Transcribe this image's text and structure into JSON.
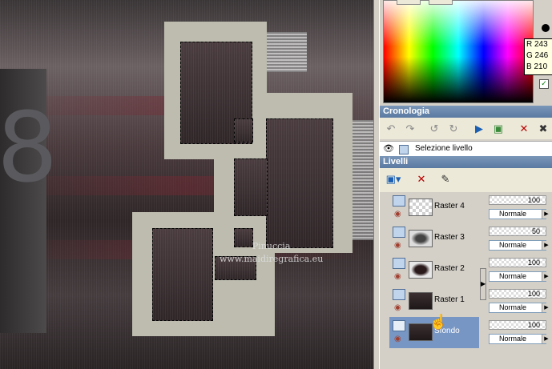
{
  "canvas": {
    "watermark_line1": "Pinuccia",
    "watermark_line2": "www.maidiregrafica.eu",
    "left_glyph": "8"
  },
  "color_picker": {
    "r": "R 243",
    "g": "G 246",
    "b": "B 210",
    "check": "✓"
  },
  "history": {
    "title": "Cronologia",
    "row_label": "Selezione livello",
    "tools": [
      "undo-icon",
      "redo-icon",
      "undo-alt-icon",
      "redo-alt-icon",
      "history-apply-icon",
      "history-copy-icon",
      "delete-history-icon",
      "clear-history-icon"
    ]
  },
  "layers": {
    "title": "Livelli",
    "items": [
      {
        "name": "Raster 4",
        "opacity": "100",
        "blend": "Normale"
      },
      {
        "name": "Raster 3",
        "opacity": "50",
        "blend": "Normale"
      },
      {
        "name": "Raster 2",
        "opacity": "100",
        "blend": "Normale"
      },
      {
        "name": "Raster 1",
        "opacity": "100",
        "blend": "Normale"
      },
      {
        "name": "Sfondo",
        "opacity": "100",
        "blend": "Normale"
      }
    ]
  },
  "colors": {
    "header_bg": "#6a88ae",
    "frame": "#bdbcaf",
    "selected_layer": "#7896c4"
  }
}
